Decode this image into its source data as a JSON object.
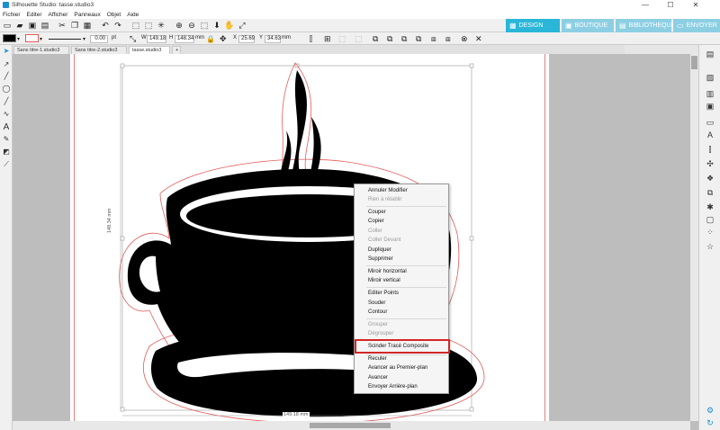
{
  "window": {
    "title": "Silhouette Studio: tasse.studio3",
    "minimize": "—",
    "maximize": "☐",
    "close": "✕"
  },
  "menu": [
    "Fichier",
    "Editer",
    "Afficher",
    "Panneaux",
    "Objet",
    "Aide"
  ],
  "nav_tabs": [
    {
      "label": "DESIGN",
      "icon": "grid-icon",
      "active": true
    },
    {
      "label": "BOUTIQUE",
      "icon": "shop-icon",
      "active": false
    },
    {
      "label": "BIBLIOTHEQUE",
      "icon": "library-icon",
      "active": false
    },
    {
      "label": "ENVOYER",
      "icon": "send-icon",
      "active": false
    }
  ],
  "line_props": {
    "width_value": "0.00",
    "unit": "pt"
  },
  "transform": {
    "w_label": "W",
    "w_value": "149.18",
    "h_label": "H",
    "h_value": "148.34",
    "hw_unit": "mm",
    "x_label": "X",
    "x_value": "25.69",
    "y_label": "Y",
    "y_value": "34.63",
    "xy_unit": "mm"
  },
  "doc_tabs": [
    {
      "label": "Sans titre-1.studio3",
      "active": false
    },
    {
      "label": "Sans titre-2.studio3",
      "active": false
    },
    {
      "label": "tasse.studio3",
      "active": true
    },
    {
      "label": "+",
      "active": false
    }
  ],
  "dimensions": {
    "width_label": "149.18 mm",
    "height_label": "148.34 mm"
  },
  "context_menu": {
    "items": [
      {
        "label": "Annuler Modifier",
        "enabled": true
      },
      {
        "label": "Rien à rétablir",
        "enabled": false
      },
      {
        "label": "Couper",
        "enabled": true
      },
      {
        "label": "Copier",
        "enabled": true
      },
      {
        "label": "Coller",
        "enabled": false
      },
      {
        "label": "Coller Devant",
        "enabled": false
      },
      {
        "label": "Dupliquer",
        "enabled": true
      },
      {
        "label": "Supprimer",
        "enabled": true
      },
      {
        "label": "Miroir horizontal",
        "enabled": true
      },
      {
        "label": "Miroir vertical",
        "enabled": true
      },
      {
        "label": "Editer Points",
        "enabled": true
      },
      {
        "label": "Souder",
        "enabled": true
      },
      {
        "label": "Contour",
        "enabled": true
      },
      {
        "label": "Grouper",
        "enabled": false
      },
      {
        "label": "Dégrouper",
        "enabled": false
      },
      {
        "label": "Scinder Tracé Composite",
        "enabled": true,
        "highlighted": true
      },
      {
        "label": "Reculer",
        "enabled": true
      },
      {
        "label": "Avancer au Premier-plan",
        "enabled": true
      },
      {
        "label": "Avancer",
        "enabled": true
      },
      {
        "label": "Envoyer Arrière-plan",
        "enabled": true
      }
    ]
  },
  "colors": {
    "accent": "#29b6d8",
    "nav_inactive": "#8ccfe3",
    "highlight_border": "#d32626",
    "cut_line": "#e35a5a"
  }
}
